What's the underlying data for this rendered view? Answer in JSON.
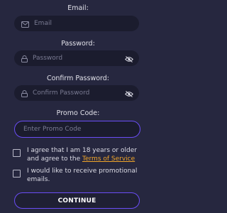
{
  "email": {
    "label": "Email:",
    "placeholder": "Email",
    "icon": "mail-icon"
  },
  "password": {
    "label": "Password:",
    "placeholder": "Password",
    "icon": "lock-icon",
    "toggle_icon": "eye-off-icon"
  },
  "confirm_password": {
    "label": "Confirm Password:",
    "placeholder": "Confirm Password",
    "icon": "lock-icon",
    "toggle_icon": "eye-off-icon"
  },
  "promo": {
    "label": "Promo Code:",
    "placeholder": "Enter Promo Code"
  },
  "agree": {
    "text": "I agree that I am 18 years or older and agree to the ",
    "link": "Terms of Service",
    "checked": false
  },
  "promotional": {
    "text": "I would like to receive promotional emails.",
    "checked": false
  },
  "continue_label": "CONTINUE",
  "colors": {
    "background": "#26273f",
    "field": "#1b1c2e",
    "accent": "#6a4df5",
    "link": "#f0a52a"
  }
}
